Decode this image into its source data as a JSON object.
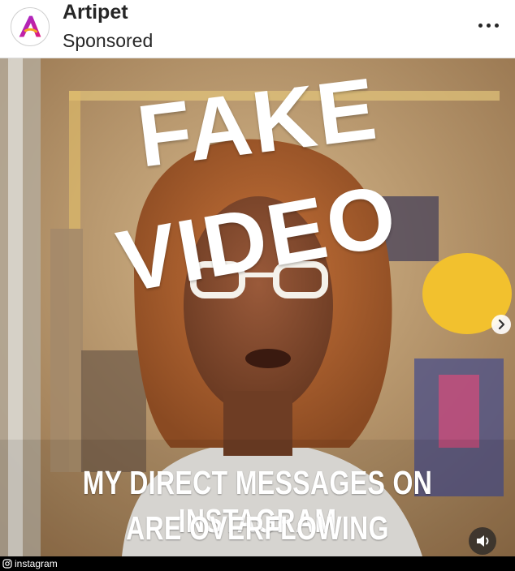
{
  "post": {
    "account_name": "Artipet",
    "sponsored_label": "Sponsored",
    "avatar_letter": "A"
  },
  "video": {
    "overlay_line1": "FAKE",
    "overlay_line2": "VIDEO",
    "caption_line1": "MY DIRECT MESSAGES ON INSTAGRAM",
    "caption_line2": "ARE OVERFLOWING"
  },
  "icons": {
    "more": "more-options-icon",
    "next": "chevron-right-icon",
    "sound": "speaker-icon",
    "source": "instagram-icon"
  },
  "footer": {
    "source_label": "instagram"
  },
  "colors": {
    "avatar_gradient_start": "#9b2bd6",
    "avatar_gradient_end": "#e0197d",
    "overlay_text": "#ffffff"
  }
}
